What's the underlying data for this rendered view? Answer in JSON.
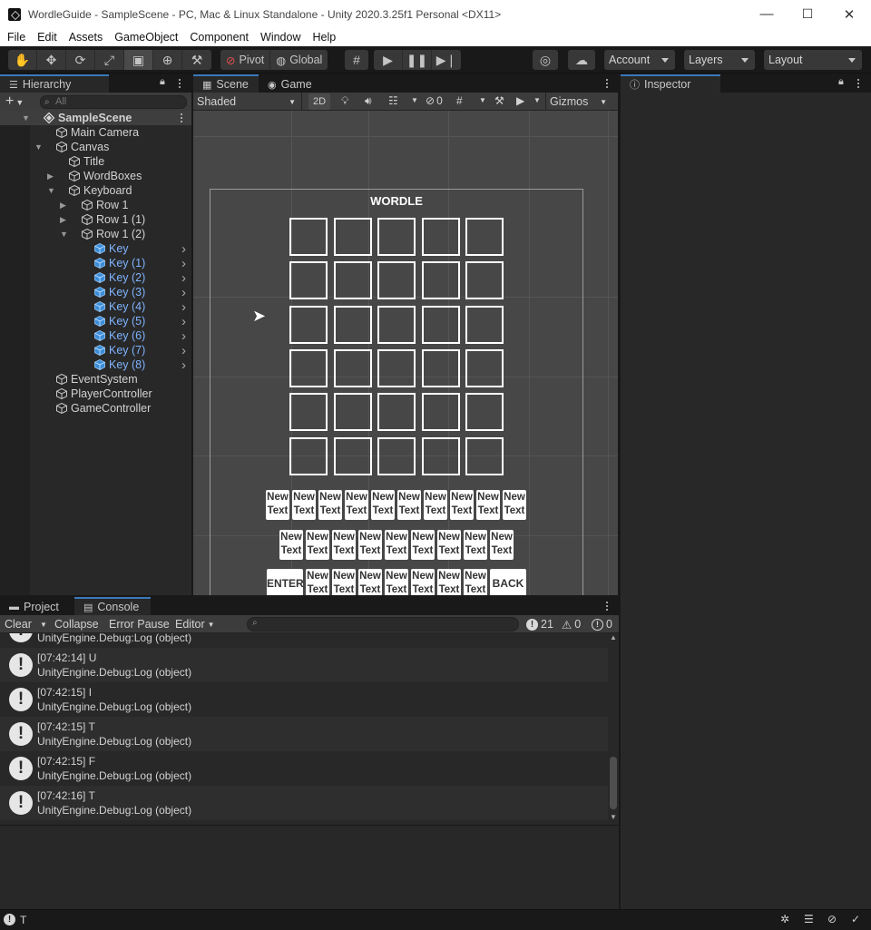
{
  "window": {
    "title": "WordleGuide - SampleScene - PC, Mac & Linux Standalone - Unity 2020.3.25f1 Personal <DX11>",
    "minimize": "—",
    "maximize": "☐",
    "close": "✕"
  },
  "menu": [
    "File",
    "Edit",
    "Assets",
    "GameObject",
    "Component",
    "Window",
    "Help"
  ],
  "toolbar": {
    "pivot": "Pivot",
    "global": "Global",
    "account": "Account",
    "layers": "Layers",
    "layout": "Layout"
  },
  "hierarchy": {
    "tab": "Hierarchy",
    "add": "+",
    "search_placeholder": "All",
    "items": [
      {
        "label": "SampleScene",
        "depth": 0,
        "kind": "scene",
        "expanded": true
      },
      {
        "label": "Main Camera",
        "depth": 1
      },
      {
        "label": "Canvas",
        "depth": 1,
        "expanded": true
      },
      {
        "label": "Title",
        "depth": 2
      },
      {
        "label": "WordBoxes",
        "depth": 2,
        "expanded": false
      },
      {
        "label": "Keyboard",
        "depth": 2,
        "expanded": true
      },
      {
        "label": "Row 1",
        "depth": 3,
        "expanded": false
      },
      {
        "label": "Row 1 (1)",
        "depth": 3,
        "expanded": false
      },
      {
        "label": "Row 1 (2)",
        "depth": 3,
        "expanded": true
      },
      {
        "label": "Key",
        "depth": 4,
        "selected": true
      },
      {
        "label": "Key (1)",
        "depth": 4,
        "selected": true
      },
      {
        "label": "Key (2)",
        "depth": 4,
        "selected": true
      },
      {
        "label": "Key (3)",
        "depth": 4,
        "selected": true
      },
      {
        "label": "Key (4)",
        "depth": 4,
        "selected": true
      },
      {
        "label": "Key (5)",
        "depth": 4,
        "selected": true
      },
      {
        "label": "Key (6)",
        "depth": 4,
        "selected": true
      },
      {
        "label": "Key (7)",
        "depth": 4,
        "selected": true
      },
      {
        "label": "Key (8)",
        "depth": 4,
        "selected": true
      },
      {
        "label": "EventSystem",
        "depth": 1
      },
      {
        "label": "PlayerController",
        "depth": 1
      },
      {
        "label": "GameController",
        "depth": 1
      }
    ]
  },
  "scene": {
    "tab_scene": "Scene",
    "tab_game": "Game",
    "shading": "Shaded",
    "mode_2d": "2D",
    "hidden_count": "0",
    "gizmos": "Gizmos",
    "wordle_title": "WORDLE",
    "key_text": "New Text",
    "enter_label": "ENTER",
    "back_label": "BACK",
    "grid_rows": 6,
    "grid_cols": 5,
    "keyboard_rows": [
      10,
      9,
      7
    ]
  },
  "inspector": {
    "tab": "Inspector"
  },
  "console": {
    "tab_project": "Project",
    "tab_console": "Console",
    "clear": "Clear",
    "collapse": "Collapse",
    "error_pause": "Error Pause",
    "editor": "Editor",
    "log_count": "21",
    "warn_count": "0",
    "error_count": "0",
    "entries": [
      {
        "time": "",
        "msg": "",
        "source": "UnityEngine.Debug:Log (object)"
      },
      {
        "time": "[07:42:14]",
        "msg": "U",
        "source": "UnityEngine.Debug:Log (object)"
      },
      {
        "time": "[07:42:15]",
        "msg": "I",
        "source": "UnityEngine.Debug:Log (object)"
      },
      {
        "time": "[07:42:15]",
        "msg": "T",
        "source": "UnityEngine.Debug:Log (object)"
      },
      {
        "time": "[07:42:15]",
        "msg": "F",
        "source": "UnityEngine.Debug:Log (object)"
      },
      {
        "time": "[07:42:16]",
        "msg": "T",
        "source": "UnityEngine.Debug:Log (object)"
      }
    ]
  },
  "status": {
    "last_message": "T"
  },
  "colors": {
    "selection_text": "#7fb3ff",
    "tab_accent": "#3a79bb",
    "panel_bg": "#282828"
  }
}
